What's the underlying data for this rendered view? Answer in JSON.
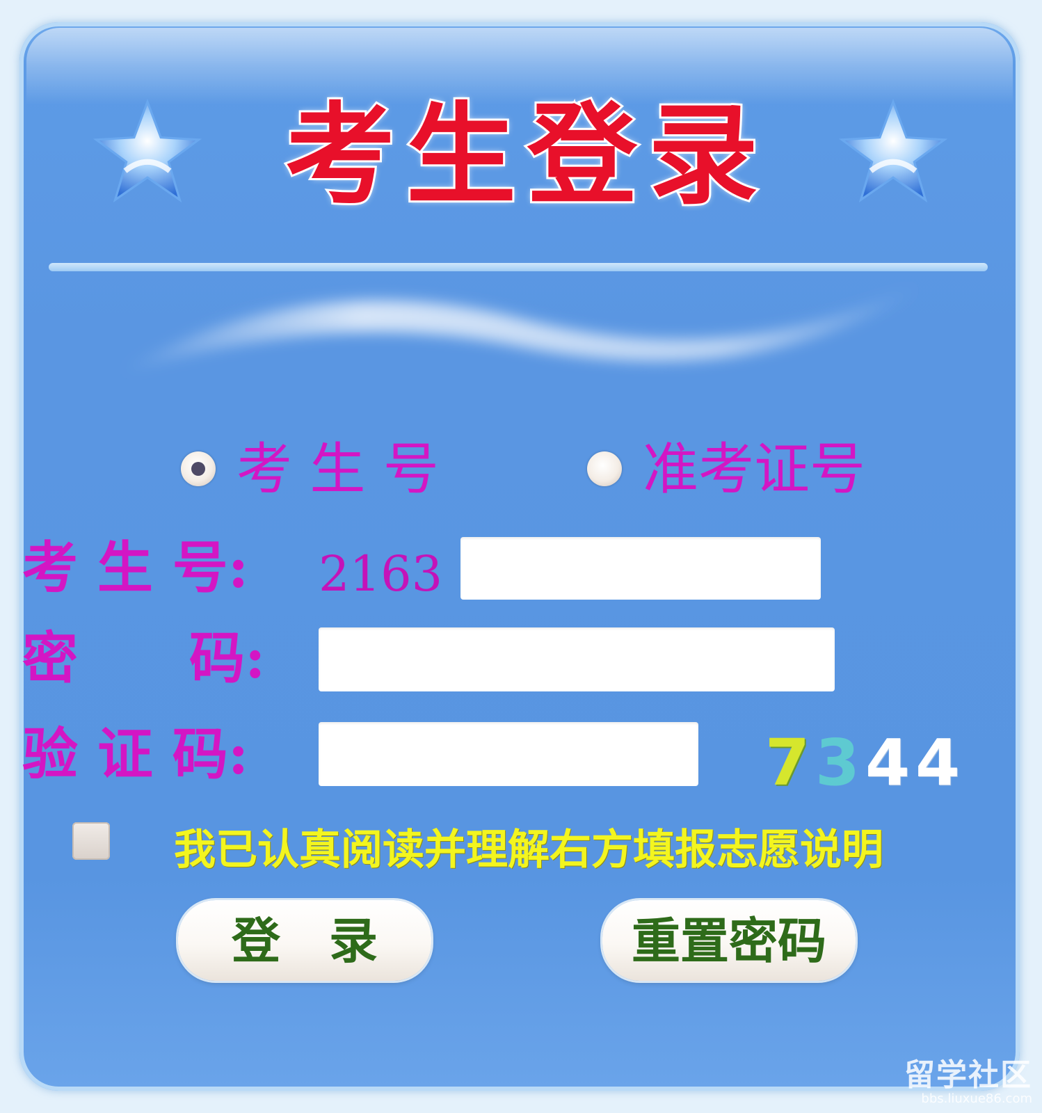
{
  "title": "考生登录",
  "login_mode": {
    "options": [
      {
        "label": "考 生 号",
        "selected": true
      },
      {
        "label": "准考证号",
        "selected": false
      }
    ]
  },
  "form": {
    "candidate_no_label": "考 生 号:",
    "candidate_no_prefix": "2163",
    "candidate_no_value": "",
    "password_label": "密　　码:",
    "password_value": "",
    "captcha_label": "验 证 码:",
    "captcha_value": "",
    "captcha_digits": [
      "7",
      "3",
      "4",
      "4"
    ]
  },
  "agreement": {
    "checked": false,
    "text": "我已认真阅读并理解右方填报志愿说明"
  },
  "buttons": {
    "login": "登　录",
    "reset_password": "重置密码"
  },
  "watermark": {
    "main": "留学社区",
    "sub": "bbs.liuxue86.com"
  },
  "colors": {
    "panel_blue": "#5895e1",
    "title_red": "#e8102a",
    "label_magenta": "#d316c4",
    "agreement_yellow": "#f3f51f",
    "button_text_green": "#2e6b1a"
  },
  "icons": {
    "left_star": "star-icon",
    "right_star": "star-icon"
  }
}
